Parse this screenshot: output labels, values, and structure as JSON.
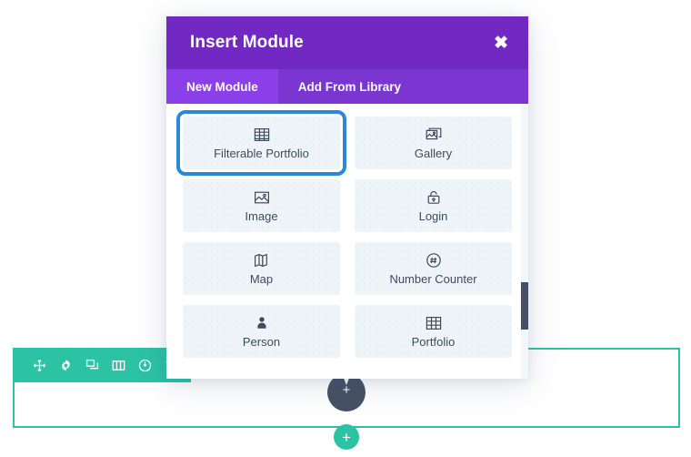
{
  "modal": {
    "title": "Insert Module",
    "close_label": "✖",
    "tabs": [
      {
        "label": "New Module",
        "active": true
      },
      {
        "label": "Add From Library",
        "active": false
      }
    ],
    "modules": [
      {
        "label": "Filterable Portfolio",
        "icon": "grid-icon",
        "selected": true
      },
      {
        "label": "Gallery",
        "icon": "gallery-icon",
        "selected": false
      },
      {
        "label": "Image",
        "icon": "image-icon",
        "selected": false
      },
      {
        "label": "Login",
        "icon": "lock-icon",
        "selected": false
      },
      {
        "label": "Map",
        "icon": "map-icon",
        "selected": false
      },
      {
        "label": "Number Counter",
        "icon": "hash-circle-icon",
        "selected": false
      },
      {
        "label": "Person",
        "icon": "person-icon",
        "selected": false
      },
      {
        "label": "Portfolio",
        "icon": "grid-icon",
        "selected": false
      }
    ]
  },
  "section_toolbar": {
    "icons": [
      "move-icon",
      "settings-gear-icon",
      "duplicate-icon",
      "columns-icon",
      "power-icon",
      "trash-icon"
    ]
  },
  "buttons": {
    "dark_add_plus": "+",
    "add_row_plus": "+"
  },
  "colors": {
    "modal_header_purple": "#7229C4",
    "tab_active_purple": "#8B3FE8",
    "tab_inactive_purple": "#7B35D0",
    "tile_background": "#EFF4F8",
    "selected_border_blue": "#2B87DA",
    "section_teal": "#2BC3A4",
    "dark_button": "#455163",
    "text_slate": "#3E4B5C"
  }
}
